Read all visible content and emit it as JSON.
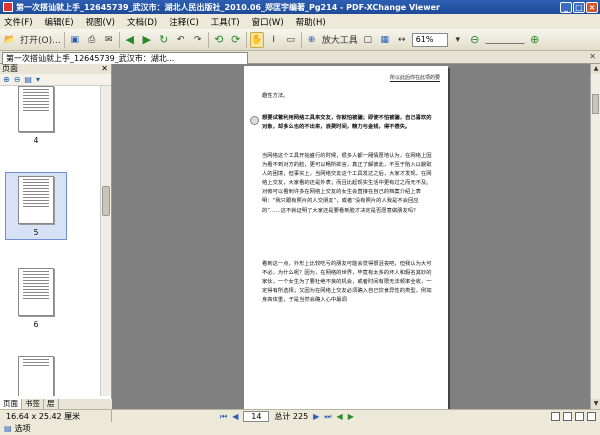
{
  "window": {
    "title": "第一次搭讪就上手_12645739_武汉市：湖北人民出版社_2010.06_郑匡宇编著_Pg214 - PDF-XChange Viewer",
    "buttons": [
      "_",
      "□",
      "×"
    ]
  },
  "menu": [
    "文件(F)",
    "编辑(E)",
    "视图(V)",
    "文档(D)",
    "注释(C)",
    "工具(T)",
    "窗口(W)",
    "帮助(H)"
  ],
  "toolbar": {
    "open_label": "打开(O)...",
    "zoom_tool_label": "放大工具",
    "zoom_value": "61%"
  },
  "tab": {
    "label": "第一次搭讪就上手_12645739_武汉市：湖北..."
  },
  "panel": {
    "title": "页面",
    "thumbnails": [
      {
        "label": "4"
      },
      {
        "label": "5"
      },
      {
        "label": "6"
      }
    ],
    "tabs": [
      "页面",
      "书签",
      "层"
    ]
  },
  "document": {
    "running_head": "所以此后你在此项的要",
    "paragraphs": [
      "趣性方法。",
      "想要试着利用网络工具来交友，你就怕被骗；即使不怕被骗，自己喜欢的对象，却多么也的不出来，浪费时间，精力与金钱，得不偿失。",
      "当网络这个工具开始盛行的时候，很多人都一厢情愿地认为，在网络上因为看不到对方的脸，更可以畅所欲言，真正了解彼此，不至于陷入以貌取人的困境，但事实上，当网络交友这个工具发达之后，大家才发现，在网络上交友，大家看的还是外表；而且比起现实生活中更有过之而无不及。对旁可以看到许多在网络上交友的女生会直接在自己的档案介绍上表明：“我只跟有照片的人交朋友”，或者“没有照片的人我是不会回应的”……这不就证明了大家还是要看到脸才决定是否愿意做朋友吗？",
      "看到这一点，外形上比较吃亏的朋友可能会觉得很沮丧吧，但我认为大可不必，为什么呢？因为，在网络的世界，毕竟有太多的坏人和假名其妙的家伙，一个女生为了要杜绝不良的机会，或者时间有限无法频率全收，一定得有所选择；又因为在网络上交友必须确入自己饮食异性的类型，例如身高体重，于是当然会确入心中最调"
    ]
  },
  "status": {
    "page_size": "16.64 x 25.42 厘米",
    "page_current": "14",
    "page_total": "总计 225",
    "options_label": "选项"
  }
}
